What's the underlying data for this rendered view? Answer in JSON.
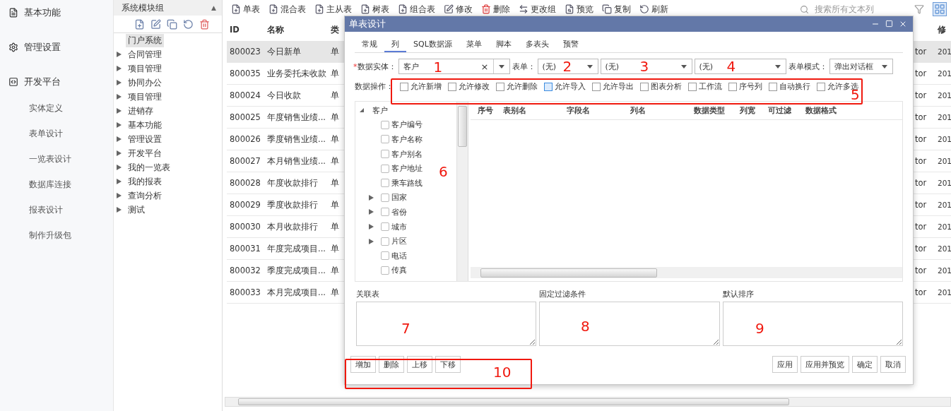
{
  "sidebar": {
    "sections": [
      {
        "label": "基本功能"
      },
      {
        "label": "管理设置"
      },
      {
        "label": "开发平台"
      }
    ],
    "items": [
      {
        "label": "实体定义"
      },
      {
        "label": "表单设计"
      },
      {
        "label": "一览表设计"
      },
      {
        "label": "数据库连接"
      },
      {
        "label": "报表设计"
      },
      {
        "label": "制作升级包"
      }
    ]
  },
  "module_panel": {
    "title": "系统模块组",
    "collapse": "▲",
    "items": [
      {
        "label": "门户系统",
        "selected": true
      },
      {
        "label": "合同管理",
        "selected": false,
        "expanded": false
      },
      {
        "label": "项目管理",
        "selected": false,
        "expanded": false
      },
      {
        "label": "协同办公",
        "selected": false,
        "expanded": false
      },
      {
        "label": "项目管理",
        "selected": false,
        "expanded": false
      },
      {
        "label": "进销存",
        "selected": false,
        "expanded": false
      },
      {
        "label": "基本功能",
        "selected": false,
        "expanded": false
      },
      {
        "label": "管理设置",
        "selected": false,
        "expanded": false
      },
      {
        "label": "开发平台",
        "selected": false,
        "expanded": false
      },
      {
        "label": "我的一览表",
        "selected": false,
        "expanded": false
      },
      {
        "label": "我的报表",
        "selected": false,
        "expanded": false
      },
      {
        "label": "查询分析",
        "selected": false,
        "expanded": false
      },
      {
        "label": "测试",
        "selected": false,
        "expanded": false
      }
    ]
  },
  "toolbar": {
    "buttons": [
      {
        "label": "单表"
      },
      {
        "label": "混合表"
      },
      {
        "label": "主从表"
      },
      {
        "label": "树表"
      },
      {
        "label": "组合表"
      },
      {
        "label": "修改"
      },
      {
        "label": "删除"
      },
      {
        "label": "更改组"
      },
      {
        "label": "预览"
      },
      {
        "label": "复制"
      },
      {
        "label": "刷新"
      }
    ],
    "search": {
      "placeholder": "搜索所有文本列"
    }
  },
  "table": {
    "header": {
      "id": "ID",
      "name": "名称",
      "type": "类",
      "column_5": "修"
    },
    "rows": [
      {
        "id": "800023",
        "name": "今日新单",
        "type": "单",
        "column_4": "tor",
        "column_5": "201",
        "selected": true
      },
      {
        "id": "800035",
        "name": "业务委托未收款",
        "type": "单",
        "column_4": "tor",
        "column_5": "201",
        "selected": false
      },
      {
        "id": "800024",
        "name": "今日收款",
        "type": "单",
        "column_4": "tor",
        "column_5": "201",
        "selected": false
      },
      {
        "id": "800025",
        "name": "年度销售业绩...",
        "type": "单",
        "column_4": "tor",
        "column_5": "201",
        "selected": false
      },
      {
        "id": "800026",
        "name": "季度销售业绩...",
        "type": "单",
        "column_4": "tor",
        "column_5": "201",
        "selected": false
      },
      {
        "id": "800027",
        "name": "本月销售业绩...",
        "type": "单",
        "column_4": "tor",
        "column_5": "201",
        "selected": false
      },
      {
        "id": "800028",
        "name": "年度收款排行",
        "type": "单",
        "column_4": "tor",
        "column_5": "201",
        "selected": false
      },
      {
        "id": "800029",
        "name": "季度收款排行",
        "type": "单",
        "column_4": "tor",
        "column_5": "201",
        "selected": false
      },
      {
        "id": "800030",
        "name": "本月收款排行",
        "type": "单",
        "column_4": "tor",
        "column_5": "201",
        "selected": false
      },
      {
        "id": "800031",
        "name": "年度完成项目...",
        "type": "单",
        "column_4": "tor",
        "column_5": "201",
        "selected": false
      },
      {
        "id": "800032",
        "name": "季度完成项目...",
        "type": "单",
        "column_4": "tor",
        "column_5": "201",
        "selected": false
      },
      {
        "id": "800033",
        "name": "本月完成项目...",
        "type": "单",
        "column_4": "tor",
        "column_5": "201",
        "selected": false
      }
    ]
  },
  "dialog": {
    "title": "单表设计",
    "tabs": [
      {
        "label": "常规",
        "selected": false
      },
      {
        "label": "列",
        "selected": true
      },
      {
        "label": "SQL数据源",
        "selected": false
      },
      {
        "label": "菜单",
        "selected": false
      },
      {
        "label": "脚本",
        "selected": false
      },
      {
        "label": "多表头",
        "selected": false
      },
      {
        "label": "预警",
        "selected": false
      }
    ],
    "entity": {
      "required_mark": "*",
      "label": "数据实体：",
      "value": "客户",
      "clear": "×"
    },
    "form": {
      "label": "表单：",
      "value": "(无)"
    },
    "select_2": {
      "value": "(无)"
    },
    "select_3": {
      "value": "(无)"
    },
    "form_mode": {
      "label": "表单模式：",
      "value": "弹出对话框"
    },
    "operations": {
      "label": "数据操作：",
      "options": [
        {
          "label": "允许新增",
          "checked": false,
          "highlighted": false
        },
        {
          "label": "允许修改",
          "checked": false,
          "highlighted": false
        },
        {
          "label": "允许删除",
          "checked": false,
          "highlighted": false
        },
        {
          "label": "允许导入",
          "checked": false,
          "highlighted": true
        },
        {
          "label": "允许导出",
          "checked": false,
          "highlighted": false
        },
        {
          "label": "图表分析",
          "checked": false,
          "highlighted": false
        },
        {
          "label": "工作流",
          "checked": false,
          "highlighted": false
        },
        {
          "label": "序号列",
          "checked": false,
          "highlighted": false
        },
        {
          "label": "自动换行",
          "checked": false,
          "highlighted": false
        },
        {
          "label": "允许多选",
          "checked": false,
          "highlighted": false
        }
      ]
    },
    "field_tree": {
      "label": "客户",
      "expanded": true,
      "children": [
        {
          "label": "客户编号",
          "checked": false
        },
        {
          "label": "客户名称",
          "checked": false
        },
        {
          "label": "客户别名",
          "checked": false
        },
        {
          "label": "客户地址",
          "checked": false
        },
        {
          "label": "乘车路线",
          "checked": false
        },
        {
          "label": "国家",
          "checked": false,
          "expanded": false
        },
        {
          "label": "省份",
          "checked": false,
          "expanded": false
        },
        {
          "label": "城市",
          "checked": false,
          "expanded": false
        },
        {
          "label": "片区",
          "checked": false,
          "expanded": false
        },
        {
          "label": "电话",
          "checked": false
        },
        {
          "label": "传真",
          "checked": false
        }
      ]
    },
    "columns_grid": {
      "columns": [
        "序号",
        "表别名",
        "字段名",
        "列名",
        "数据类型",
        "列宽",
        "可过滤",
        "数据格式"
      ]
    },
    "text_areas": [
      {
        "label": "关联表"
      },
      {
        "label": "固定过滤条件"
      },
      {
        "label": "默认排序"
      }
    ],
    "left_buttons": [
      "增加",
      "删除",
      "上移",
      "下移"
    ],
    "right_buttons": [
      "应用",
      "应用并预览",
      "确定",
      "取消"
    ]
  },
  "annotations": {
    "labels": [
      "1",
      "2",
      "3",
      "4",
      "5",
      "6",
      "7",
      "8",
      "9",
      "10"
    ]
  }
}
